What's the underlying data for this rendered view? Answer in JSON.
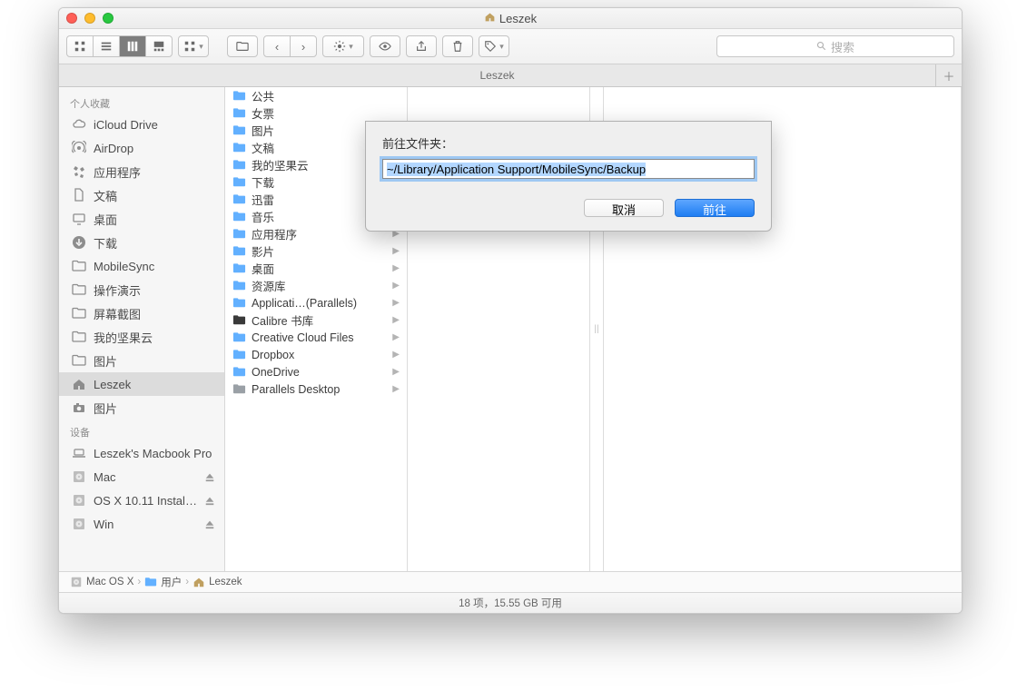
{
  "window": {
    "title": "Leszek",
    "tab_label": "Leszek",
    "search_placeholder": "搜索"
  },
  "sidebar": {
    "section1": "个人收藏",
    "section2": "设备",
    "favorites": [
      {
        "label": "iCloud Drive",
        "icon": "cloud"
      },
      {
        "label": "AirDrop",
        "icon": "airdrop"
      },
      {
        "label": "应用程序",
        "icon": "apps"
      },
      {
        "label": "文稿",
        "icon": "doc"
      },
      {
        "label": "桌面",
        "icon": "desktop"
      },
      {
        "label": "下载",
        "icon": "download"
      },
      {
        "label": "MobileSync",
        "icon": "folder"
      },
      {
        "label": "操作演示",
        "icon": "folder"
      },
      {
        "label": "屏幕截图",
        "icon": "folder"
      },
      {
        "label": "我的坚果云",
        "icon": "folder"
      },
      {
        "label": "图片",
        "icon": "folder"
      },
      {
        "label": "Leszek",
        "icon": "home",
        "selected": true
      },
      {
        "label": "图片",
        "icon": "camera"
      }
    ],
    "devices": [
      {
        "label": "Leszek's Macbook Pro",
        "icon": "laptop"
      },
      {
        "label": "Mac",
        "icon": "disk",
        "eject": true
      },
      {
        "label": "OS X 10.11 Install…",
        "icon": "disk",
        "eject": true
      },
      {
        "label": "Win",
        "icon": "disk",
        "eject": true
      }
    ]
  },
  "column1": [
    {
      "name": "公共",
      "icon": "folder"
    },
    {
      "name": "女票",
      "icon": "folder"
    },
    {
      "name": "图片",
      "icon": "folder"
    },
    {
      "name": "文稿",
      "icon": "folder"
    },
    {
      "name": "我的坚果云",
      "icon": "folder"
    },
    {
      "name": "下载",
      "icon": "folder"
    },
    {
      "name": "迅雷",
      "icon": "folder"
    },
    {
      "name": "音乐",
      "icon": "folder",
      "arrow": true
    },
    {
      "name": "应用程序",
      "icon": "folder",
      "arrow": true
    },
    {
      "name": "影片",
      "icon": "folder",
      "arrow": true
    },
    {
      "name": "桌面",
      "icon": "folder",
      "arrow": true
    },
    {
      "name": "资源库",
      "icon": "folder",
      "arrow": true
    },
    {
      "name": "Applicati…(Parallels)",
      "icon": "folder",
      "arrow": true
    },
    {
      "name": "Calibre 书库",
      "icon": "dark",
      "arrow": true
    },
    {
      "name": "Creative Cloud Files",
      "icon": "folder",
      "arrow": true
    },
    {
      "name": "Dropbox",
      "icon": "folder",
      "arrow": true
    },
    {
      "name": "OneDrive",
      "icon": "folder",
      "arrow": true
    },
    {
      "name": "Parallels Desktop",
      "icon": "grey",
      "arrow": true
    }
  ],
  "pathbar": {
    "p1": "Mac OS X",
    "p2": "用户",
    "p3": "Leszek"
  },
  "status": "18 项，15.55 GB 可用",
  "dialog": {
    "label": "前往文件夹：",
    "value": "~/Library/Application Support/MobileSync/Backup",
    "cancel": "取消",
    "go": "前往"
  }
}
